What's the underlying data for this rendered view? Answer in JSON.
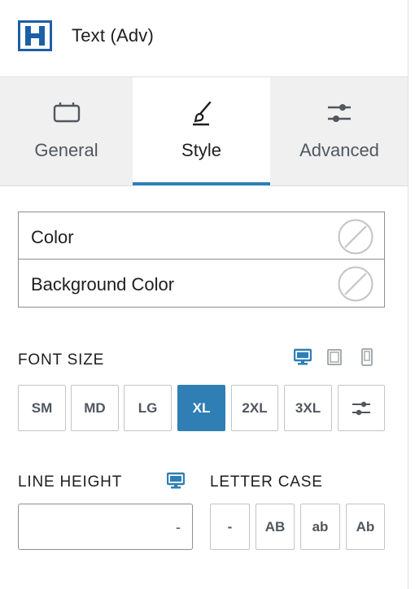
{
  "header": {
    "title": "Text (Adv)",
    "icon": "heading-block-icon"
  },
  "tabs": [
    {
      "label": "General",
      "icon": "general-box-icon"
    },
    {
      "label": "Style",
      "icon": "brush-icon",
      "active": true
    },
    {
      "label": "Advanced",
      "icon": "sliders-icon"
    }
  ],
  "colors": [
    {
      "label": "Color"
    },
    {
      "label": "Background Color"
    }
  ],
  "font_size": {
    "label": "FONT SIZE",
    "options": [
      "SM",
      "MD",
      "LG",
      "XL",
      "2XL",
      "3XL"
    ],
    "selected": "XL",
    "devices": [
      "desktop",
      "tablet",
      "mobile"
    ]
  },
  "line_height": {
    "label": "LINE HEIGHT",
    "value": "-"
  },
  "letter_case": {
    "label": "LETTER CASE",
    "options": [
      "-",
      "AB",
      "ab",
      "Ab"
    ]
  },
  "theme": {
    "accent": "#2f7fb5",
    "tab_bg": "#f0f0f1",
    "border": "#8c8f94"
  }
}
